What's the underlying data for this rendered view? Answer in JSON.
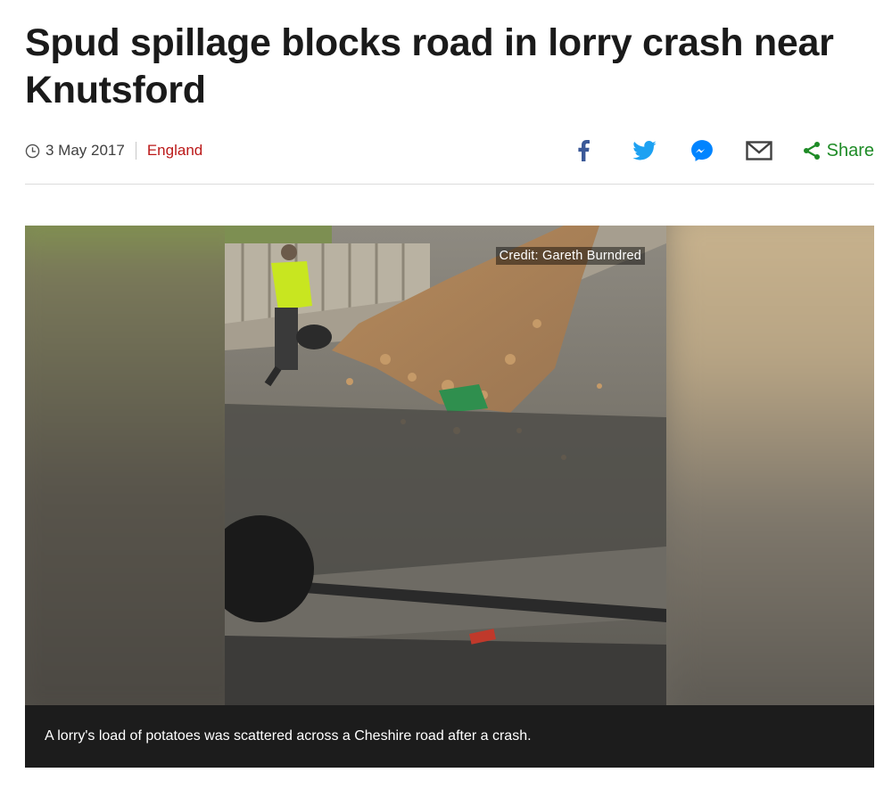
{
  "article": {
    "headline": "Spud spillage blocks road in lorry crash near Knutsford",
    "date": "3 May 2017",
    "section": "England"
  },
  "share_tools": {
    "items": [
      {
        "name": "facebook",
        "icon": "facebook-icon",
        "color": "#3b5998"
      },
      {
        "name": "twitter",
        "icon": "twitter-icon",
        "color": "#1da1f2"
      },
      {
        "name": "messenger",
        "icon": "messenger-icon",
        "color": "#0084ff"
      },
      {
        "name": "email",
        "icon": "email-icon",
        "color": "#404040"
      }
    ],
    "share_label": "Share",
    "share_color": "#1e8b26"
  },
  "media": {
    "credit": "Credit: Gareth Burndred",
    "caption": "A lorry's load of potatoes was scattered across a Cheshire road after a crash."
  },
  "colors": {
    "section_link": "#bb1919",
    "caption_bg": "#1c1c1c"
  }
}
